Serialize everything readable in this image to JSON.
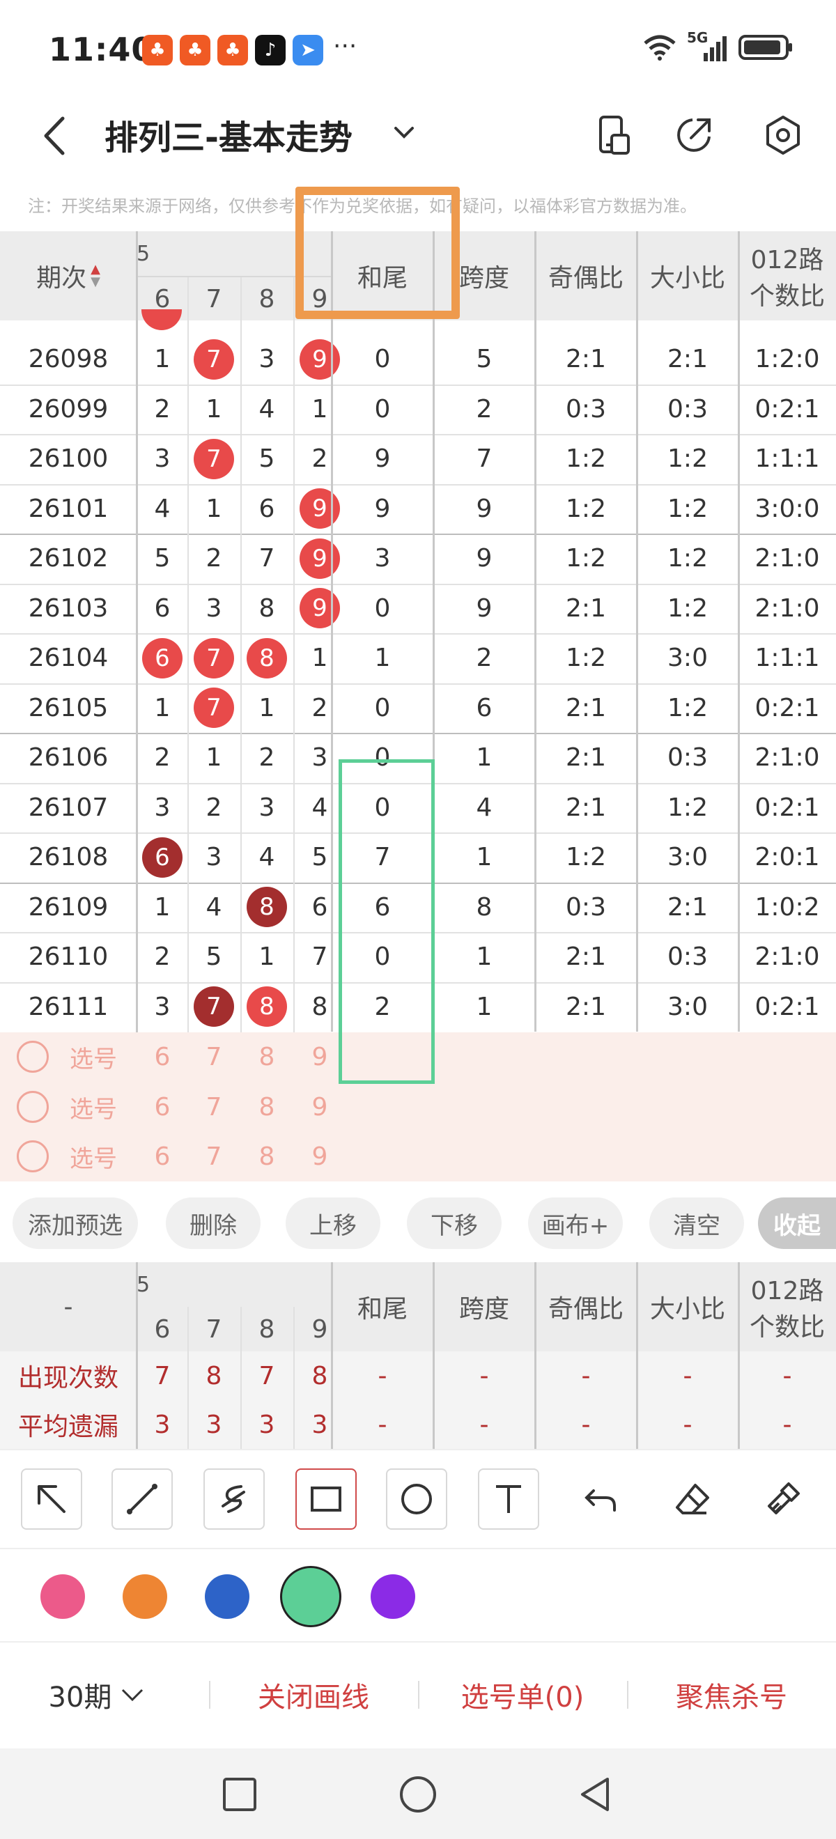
{
  "status_bar": {
    "time": "11:40",
    "more": "···",
    "network": "5G",
    "app_icons": [
      "kuaishou-icon",
      "kuaishou-icon",
      "kuaishou-icon",
      "tiktok-icon",
      "feishu-icon"
    ]
  },
  "header": {
    "title": "排列三-基本走势"
  },
  "note": "注：开奖结果来源于网络，仅供参考不作为兑奖依据，如有疑问，以福体彩官方数据为准。",
  "table": {
    "col_period": "期次",
    "col_digits_partial": "5",
    "digit_headers": [
      "6",
      "7",
      "8",
      "9"
    ],
    "col_hewei": "和尾",
    "col_kuadu": "跨度",
    "col_jiou": "奇偶比",
    "col_daxiao": "大小比",
    "col_012_line1": "012路",
    "col_012_line2": "个数比",
    "rows": [
      {
        "period": "26098",
        "d": [
          "1",
          "7",
          "3",
          "9"
        ],
        "b": [
          "",
          "red",
          "",
          "red"
        ],
        "hewei": "0",
        "kuadu": "5",
        "jiou": "2:1",
        "daxiao": "2:1",
        "r012": "1:2:0"
      },
      {
        "period": "26099",
        "d": [
          "2",
          "1",
          "4",
          "1"
        ],
        "b": [
          "",
          "",
          "",
          ""
        ],
        "hewei": "0",
        "kuadu": "2",
        "jiou": "0:3",
        "daxiao": "0:3",
        "r012": "0:2:1"
      },
      {
        "period": "26100",
        "d": [
          "3",
          "7",
          "5",
          "2"
        ],
        "b": [
          "",
          "red",
          "",
          ""
        ],
        "hewei": "9",
        "kuadu": "7",
        "jiou": "1:2",
        "daxiao": "1:2",
        "r012": "1:1:1"
      },
      {
        "period": "26101",
        "d": [
          "4",
          "1",
          "6",
          "9"
        ],
        "b": [
          "",
          "",
          "",
          "red"
        ],
        "hewei": "9",
        "kuadu": "9",
        "jiou": "1:2",
        "daxiao": "1:2",
        "r012": "3:0:0"
      },
      {
        "period": "26102",
        "d": [
          "5",
          "2",
          "7",
          "9"
        ],
        "b": [
          "",
          "",
          "",
          "red"
        ],
        "hewei": "3",
        "kuadu": "9",
        "jiou": "1:2",
        "daxiao": "1:2",
        "r012": "2:1:0"
      },
      {
        "period": "26103",
        "d": [
          "6",
          "3",
          "8",
          "9"
        ],
        "b": [
          "",
          "",
          "",
          "red"
        ],
        "hewei": "0",
        "kuadu": "9",
        "jiou": "2:1",
        "daxiao": "1:2",
        "r012": "2:1:0"
      },
      {
        "period": "26104",
        "d": [
          "6",
          "7",
          "8",
          "1"
        ],
        "b": [
          "red",
          "red",
          "red",
          ""
        ],
        "hewei": "1",
        "kuadu": "2",
        "jiou": "1:2",
        "daxiao": "3:0",
        "r012": "1:1:1"
      },
      {
        "period": "26105",
        "d": [
          "1",
          "7",
          "1",
          "2"
        ],
        "b": [
          "",
          "red",
          "",
          ""
        ],
        "hewei": "0",
        "kuadu": "6",
        "jiou": "2:1",
        "daxiao": "1:2",
        "r012": "0:2:1"
      },
      {
        "period": "26106",
        "d": [
          "2",
          "1",
          "2",
          "3"
        ],
        "b": [
          "",
          "",
          "",
          ""
        ],
        "hewei": "0",
        "kuadu": "1",
        "jiou": "2:1",
        "daxiao": "0:3",
        "r012": "2:1:0"
      },
      {
        "period": "26107",
        "d": [
          "3",
          "2",
          "3",
          "4"
        ],
        "b": [
          "",
          "",
          "",
          ""
        ],
        "hewei": "0",
        "kuadu": "4",
        "jiou": "2:1",
        "daxiao": "1:2",
        "r012": "0:2:1"
      },
      {
        "period": "26108",
        "d": [
          "6",
          "3",
          "4",
          "5"
        ],
        "b": [
          "dark",
          "",
          "",
          ""
        ],
        "hewei": "7",
        "kuadu": "1",
        "jiou": "1:2",
        "daxiao": "3:0",
        "r012": "2:0:1"
      },
      {
        "period": "26109",
        "d": [
          "1",
          "4",
          "8",
          "6"
        ],
        "b": [
          "",
          "",
          "dark",
          ""
        ],
        "hewei": "6",
        "kuadu": "8",
        "jiou": "0:3",
        "daxiao": "2:1",
        "r012": "1:0:2"
      },
      {
        "period": "26110",
        "d": [
          "2",
          "5",
          "1",
          "7"
        ],
        "b": [
          "",
          "",
          "",
          ""
        ],
        "hewei": "0",
        "kuadu": "1",
        "jiou": "2:1",
        "daxiao": "0:3",
        "r012": "2:1:0"
      },
      {
        "period": "26111",
        "d": [
          "3",
          "7",
          "8",
          "8"
        ],
        "b": [
          "",
          "dark",
          "red",
          ""
        ],
        "hewei": "2",
        "kuadu": "1",
        "jiou": "2:1",
        "daxiao": "3:0",
        "r012": "0:2:1"
      }
    ],
    "pick_rows": [
      {
        "label": "选号",
        "nums": [
          "6",
          "7",
          "8",
          "9"
        ]
      },
      {
        "label": "选号",
        "nums": [
          "6",
          "7",
          "8",
          "9"
        ]
      },
      {
        "label": "选号",
        "nums": [
          "6",
          "7",
          "8",
          "9"
        ]
      }
    ]
  },
  "actions": {
    "add": "添加预选",
    "delete": "删除",
    "up": "上移",
    "down": "下移",
    "canvas": "画布+",
    "clear": "清空",
    "collapse": "收起"
  },
  "stats": {
    "corner": "-",
    "col_digits_partial": "5",
    "digit_headers": [
      "6",
      "7",
      "8",
      "9"
    ],
    "col_hewei": "和尾",
    "col_kuadu": "跨度",
    "col_jiou": "奇偶比",
    "col_daxiao": "大小比",
    "col_012_line1": "012路",
    "col_012_line2": "个数比",
    "rows": [
      {
        "label": "出现次数",
        "d": [
          "7",
          "8",
          "7",
          "8"
        ],
        "rest": [
          "-",
          "-",
          "-",
          "-",
          "-"
        ]
      },
      {
        "label": "平均遗漏",
        "d": [
          "3",
          "3",
          "3",
          "3"
        ],
        "rest": [
          "-",
          "-",
          "-",
          "-",
          "-"
        ]
      }
    ]
  },
  "tools": [
    "arrow-tool-icon",
    "line-tool-icon",
    "freehand-tool-icon",
    "rectangle-tool-icon",
    "circle-tool-icon",
    "text-tool-icon",
    "undo-icon",
    "eraser-icon",
    "clear-brush-icon"
  ],
  "colors": {
    "swatches": [
      "#ec5a8a",
      "#ee8533",
      "#2d63c8",
      "#5ccf96",
      "#8b2be6"
    ],
    "selected": "#5ccf96",
    "annotation_orange": "#ee9a4d",
    "annotation_green": "#5ccf96",
    "accent_red": "#d04040"
  },
  "bottom_bar": {
    "periods": "30期",
    "close_lines": "关闭画线",
    "pick_list": "选号单(0)",
    "focus_kill": "聚焦杀号"
  }
}
